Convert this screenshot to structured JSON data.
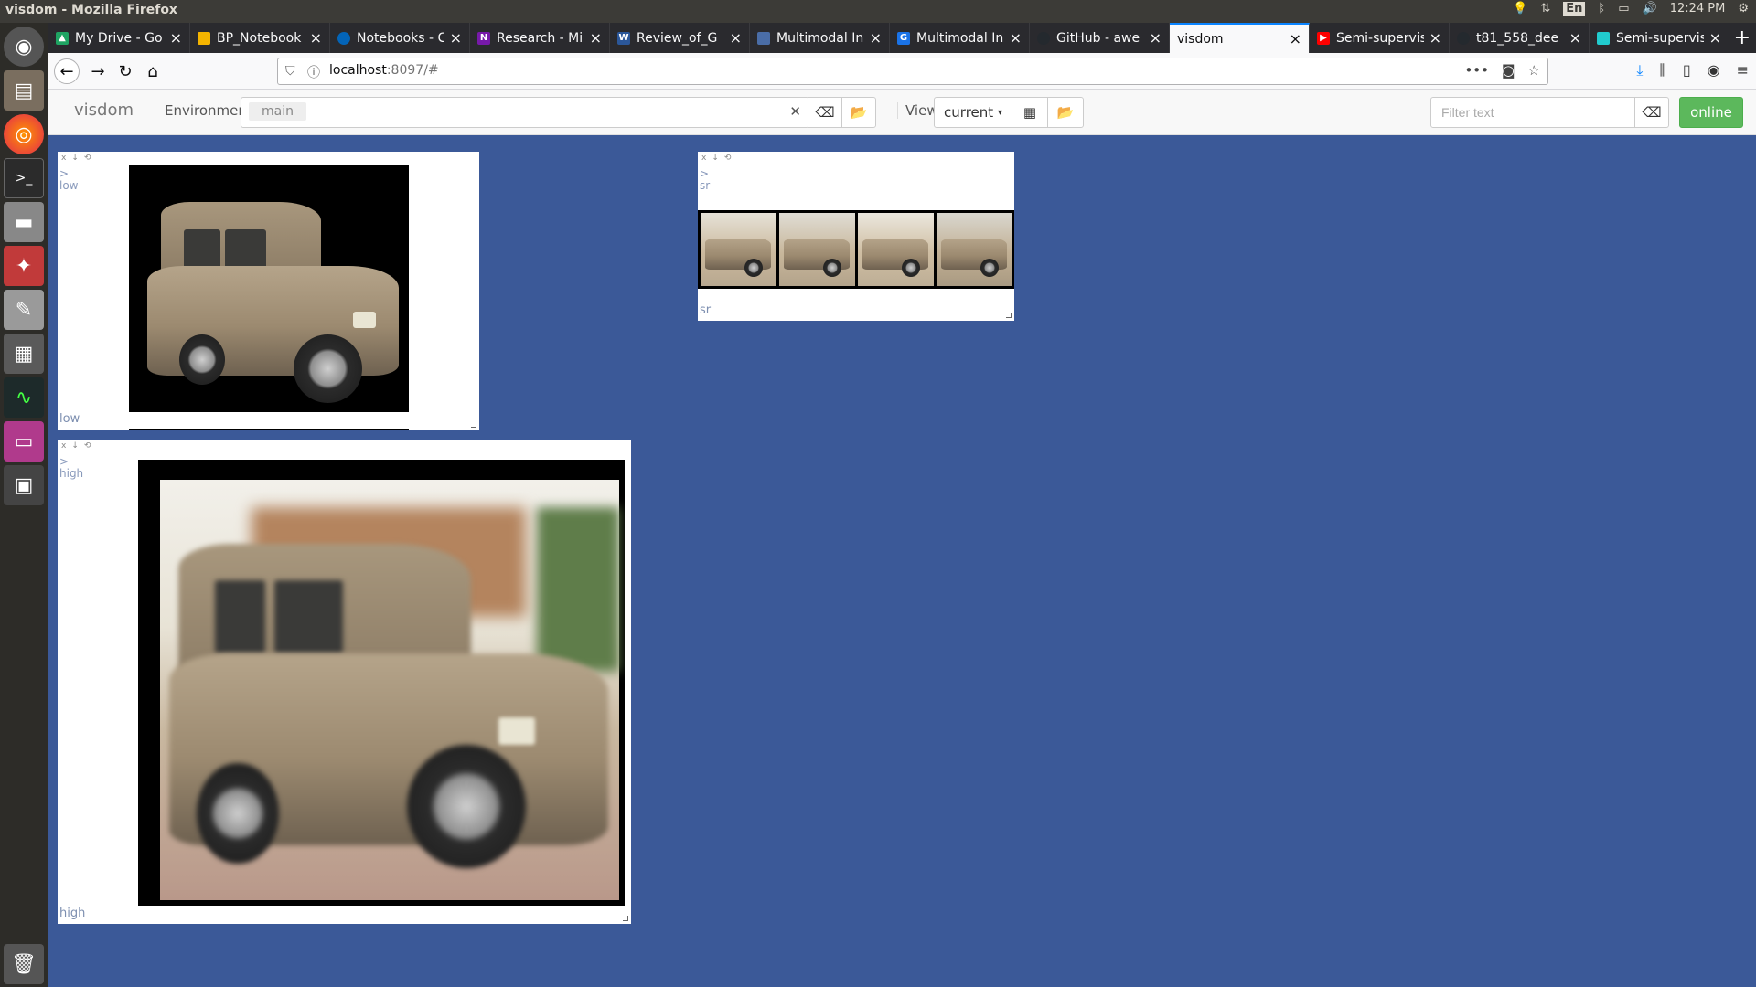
{
  "system": {
    "window_title": "visdom - Mozilla Firefox",
    "keyboard_layout": "En",
    "clock": "12:24 PM"
  },
  "tabs": [
    {
      "label": "My Drive - Go",
      "icon": "google-drive-icon",
      "color": "#1fa463"
    },
    {
      "label": "BP_Notebook",
      "icon": "slides-icon",
      "color": "#f4b400"
    },
    {
      "label": "Notebooks - C",
      "icon": "onedrive-icon",
      "color": "#0364b8"
    },
    {
      "label": "Research - Mi",
      "icon": "onenote-icon",
      "color": "#7719aa"
    },
    {
      "label": "Review_of_G",
      "icon": "word-icon",
      "color": "#2b579a"
    },
    {
      "label": "Multimodal In",
      "icon": "doc-icon",
      "color": "#4a6da7"
    },
    {
      "label": "Multimodal In",
      "icon": "gf-icon",
      "color": "#1a73e8"
    },
    {
      "label": "GitHub - awe",
      "icon": "github-icon",
      "color": "#24292e"
    },
    {
      "label": "visdom",
      "icon": "",
      "color": "#ffffff"
    },
    {
      "label": "Semi-supervis",
      "icon": "youtube-icon",
      "color": "#ff0000"
    },
    {
      "label": "t81_558_dee",
      "icon": "github-icon",
      "color": "#24292e"
    },
    {
      "label": "Semi-supervis",
      "icon": "paperswithcode-icon",
      "color": "#21cbce"
    }
  ],
  "navbar": {
    "url_host": "localhost",
    "url_rest": ":8097/#"
  },
  "visdom": {
    "brand": "visdom",
    "environment_label": "Environment",
    "environment_chip": "main",
    "view_label": "View",
    "view_selected": "current",
    "filter_placeholder": "Filter text",
    "online_label": "online"
  },
  "panes": {
    "low": {
      "prompt": ">",
      "title": "low",
      "caption": "low"
    },
    "sr": {
      "prompt": ">",
      "title": "sr",
      "caption": "sr"
    },
    "high": {
      "prompt": ">",
      "title": "high",
      "caption": "high"
    }
  }
}
